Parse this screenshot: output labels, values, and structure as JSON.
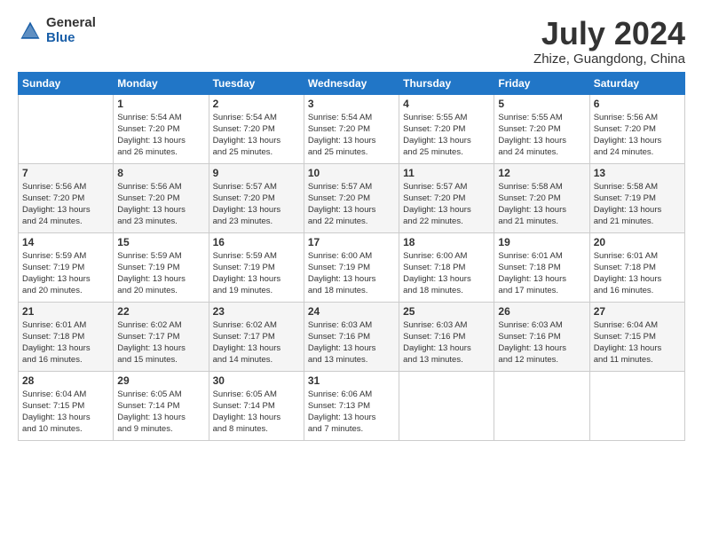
{
  "logo": {
    "general": "General",
    "blue": "Blue"
  },
  "title": "July 2024",
  "location": "Zhize, Guangdong, China",
  "days_header": [
    "Sunday",
    "Monday",
    "Tuesday",
    "Wednesday",
    "Thursday",
    "Friday",
    "Saturday"
  ],
  "weeks": [
    [
      {
        "day": "",
        "info": ""
      },
      {
        "day": "1",
        "info": "Sunrise: 5:54 AM\nSunset: 7:20 PM\nDaylight: 13 hours\nand 26 minutes."
      },
      {
        "day": "2",
        "info": "Sunrise: 5:54 AM\nSunset: 7:20 PM\nDaylight: 13 hours\nand 25 minutes."
      },
      {
        "day": "3",
        "info": "Sunrise: 5:54 AM\nSunset: 7:20 PM\nDaylight: 13 hours\nand 25 minutes."
      },
      {
        "day": "4",
        "info": "Sunrise: 5:55 AM\nSunset: 7:20 PM\nDaylight: 13 hours\nand 25 minutes."
      },
      {
        "day": "5",
        "info": "Sunrise: 5:55 AM\nSunset: 7:20 PM\nDaylight: 13 hours\nand 24 minutes."
      },
      {
        "day": "6",
        "info": "Sunrise: 5:56 AM\nSunset: 7:20 PM\nDaylight: 13 hours\nand 24 minutes."
      }
    ],
    [
      {
        "day": "7",
        "info": "Sunrise: 5:56 AM\nSunset: 7:20 PM\nDaylight: 13 hours\nand 24 minutes."
      },
      {
        "day": "8",
        "info": "Sunrise: 5:56 AM\nSunset: 7:20 PM\nDaylight: 13 hours\nand 23 minutes."
      },
      {
        "day": "9",
        "info": "Sunrise: 5:57 AM\nSunset: 7:20 PM\nDaylight: 13 hours\nand 23 minutes."
      },
      {
        "day": "10",
        "info": "Sunrise: 5:57 AM\nSunset: 7:20 PM\nDaylight: 13 hours\nand 22 minutes."
      },
      {
        "day": "11",
        "info": "Sunrise: 5:57 AM\nSunset: 7:20 PM\nDaylight: 13 hours\nand 22 minutes."
      },
      {
        "day": "12",
        "info": "Sunrise: 5:58 AM\nSunset: 7:20 PM\nDaylight: 13 hours\nand 21 minutes."
      },
      {
        "day": "13",
        "info": "Sunrise: 5:58 AM\nSunset: 7:19 PM\nDaylight: 13 hours\nand 21 minutes."
      }
    ],
    [
      {
        "day": "14",
        "info": "Sunrise: 5:59 AM\nSunset: 7:19 PM\nDaylight: 13 hours\nand 20 minutes."
      },
      {
        "day": "15",
        "info": "Sunrise: 5:59 AM\nSunset: 7:19 PM\nDaylight: 13 hours\nand 20 minutes."
      },
      {
        "day": "16",
        "info": "Sunrise: 5:59 AM\nSunset: 7:19 PM\nDaylight: 13 hours\nand 19 minutes."
      },
      {
        "day": "17",
        "info": "Sunrise: 6:00 AM\nSunset: 7:19 PM\nDaylight: 13 hours\nand 18 minutes."
      },
      {
        "day": "18",
        "info": "Sunrise: 6:00 AM\nSunset: 7:18 PM\nDaylight: 13 hours\nand 18 minutes."
      },
      {
        "day": "19",
        "info": "Sunrise: 6:01 AM\nSunset: 7:18 PM\nDaylight: 13 hours\nand 17 minutes."
      },
      {
        "day": "20",
        "info": "Sunrise: 6:01 AM\nSunset: 7:18 PM\nDaylight: 13 hours\nand 16 minutes."
      }
    ],
    [
      {
        "day": "21",
        "info": "Sunrise: 6:01 AM\nSunset: 7:18 PM\nDaylight: 13 hours\nand 16 minutes."
      },
      {
        "day": "22",
        "info": "Sunrise: 6:02 AM\nSunset: 7:17 PM\nDaylight: 13 hours\nand 15 minutes."
      },
      {
        "day": "23",
        "info": "Sunrise: 6:02 AM\nSunset: 7:17 PM\nDaylight: 13 hours\nand 14 minutes."
      },
      {
        "day": "24",
        "info": "Sunrise: 6:03 AM\nSunset: 7:16 PM\nDaylight: 13 hours\nand 13 minutes."
      },
      {
        "day": "25",
        "info": "Sunrise: 6:03 AM\nSunset: 7:16 PM\nDaylight: 13 hours\nand 13 minutes."
      },
      {
        "day": "26",
        "info": "Sunrise: 6:03 AM\nSunset: 7:16 PM\nDaylight: 13 hours\nand 12 minutes."
      },
      {
        "day": "27",
        "info": "Sunrise: 6:04 AM\nSunset: 7:15 PM\nDaylight: 13 hours\nand 11 minutes."
      }
    ],
    [
      {
        "day": "28",
        "info": "Sunrise: 6:04 AM\nSunset: 7:15 PM\nDaylight: 13 hours\nand 10 minutes."
      },
      {
        "day": "29",
        "info": "Sunrise: 6:05 AM\nSunset: 7:14 PM\nDaylight: 13 hours\nand 9 minutes."
      },
      {
        "day": "30",
        "info": "Sunrise: 6:05 AM\nSunset: 7:14 PM\nDaylight: 13 hours\nand 8 minutes."
      },
      {
        "day": "31",
        "info": "Sunrise: 6:06 AM\nSunset: 7:13 PM\nDaylight: 13 hours\nand 7 minutes."
      },
      {
        "day": "",
        "info": ""
      },
      {
        "day": "",
        "info": ""
      },
      {
        "day": "",
        "info": ""
      }
    ]
  ]
}
